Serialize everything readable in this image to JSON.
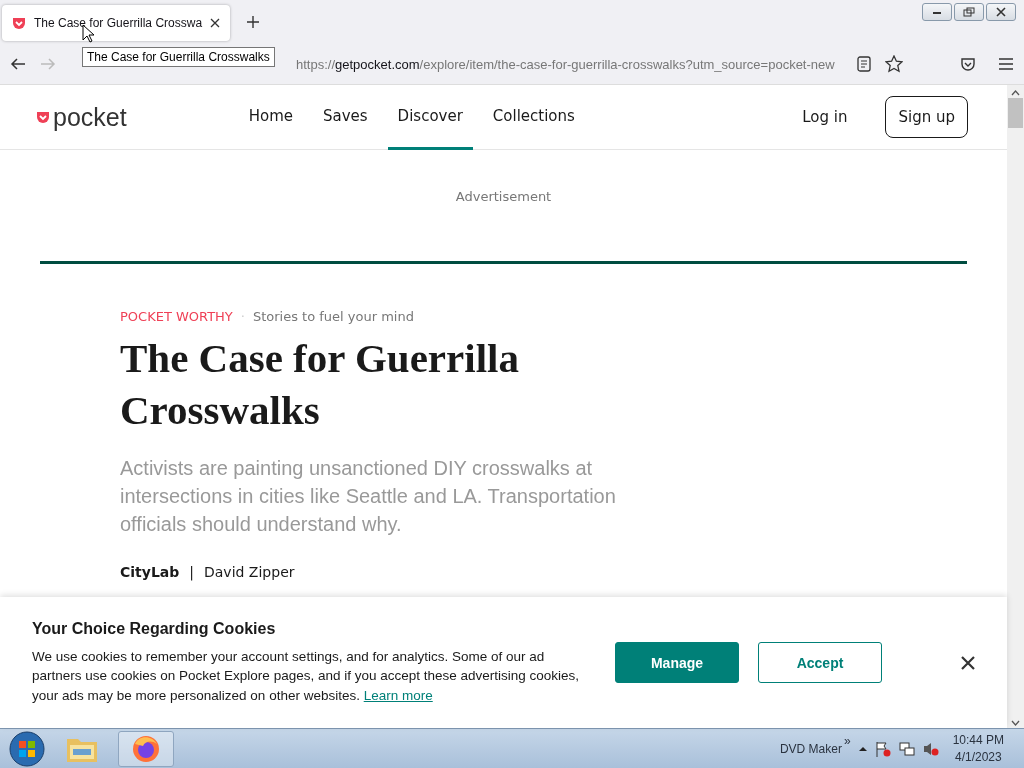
{
  "browser": {
    "tab": {
      "title": "The Case for Guerrilla Crosswa",
      "selected": true
    },
    "tooltip": "The Case for Guerrilla Crosswalks",
    "url": {
      "scheme": "https://",
      "host": "getpocket.com",
      "path": "/explore/item/the-case-for-guerrilla-crosswalks?utm_source=pocket-new"
    }
  },
  "site_header": {
    "logo": "pocket",
    "nav": [
      {
        "label": "Home",
        "selected": false
      },
      {
        "label": "Saves",
        "selected": false
      },
      {
        "label": "Discover",
        "selected": true
      },
      {
        "label": "Collections",
        "selected": false
      }
    ],
    "login": "Log in",
    "signup": "Sign up"
  },
  "advertisement": "Advertisement",
  "article": {
    "kicker": "POCKET WORTHY",
    "kicker_separator": "·",
    "tagline": "Stories to fuel your mind",
    "title": "The Case for Guerrilla Crosswalks",
    "excerpt": "Activists are painting unsanctioned DIY crosswalks at intersections in cities like Seattle and LA. Transportation officials should understand why.",
    "publisher": "CityLab",
    "separator": "|",
    "author": "David Zipper"
  },
  "cookie_banner": {
    "title": "Your Choice Regarding Cookies",
    "text": "We use cookies to remember your account settings, and for analytics. Some of our ad partners use cookies on Pocket Explore pages, and if you accept these advertising cookies, your ads may be more personalized on other websites.",
    "link": "Learn more",
    "buttons": [
      {
        "label": "Manage",
        "kind": "primary"
      },
      {
        "label": "Accept",
        "kind": "secondary"
      }
    ]
  },
  "taskbar": {
    "toolbar": "DVD Maker",
    "overflow": "»",
    "time": "10:44 PM",
    "date": "4/1/2023"
  }
}
